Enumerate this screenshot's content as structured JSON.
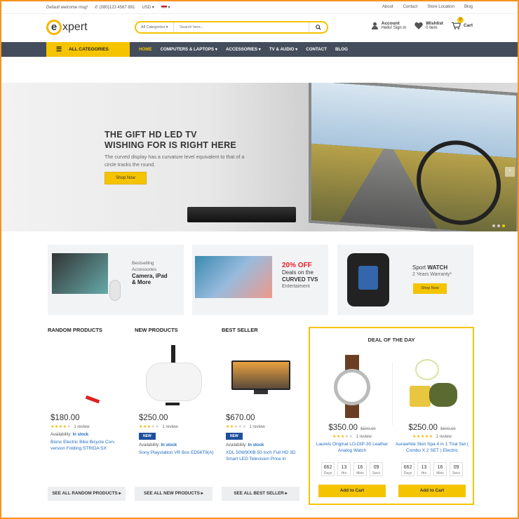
{
  "topbar": {
    "welcome": "Default welcome msg!",
    "phone": "(080)123 4567 891",
    "currency": "USD",
    "links": [
      "About",
      "Contact",
      "Store Location",
      "Blog"
    ]
  },
  "header": {
    "logo_letter": "e",
    "logo_text": "xpert",
    "search_category": "All Categories",
    "search_placeholder": "Search here...",
    "account_title": "Account",
    "account_sub": "Hello! Sign in",
    "wishlist_title": "Wishlist",
    "wishlist_sub": "0 item",
    "cart_count": "0",
    "cart_label": "Cart"
  },
  "nav": {
    "all_categories": "ALL CATEGORIES",
    "items": [
      "HOME",
      "COMPUTERS & LAPTOPS",
      "ACCESSORIES",
      "TV & AUDIO",
      "CONTACT",
      "BLOG"
    ]
  },
  "slider": {
    "title_1": "THE GIFT HD LED TV",
    "title_2": "WISHING FOR IS RIGHT HERE",
    "text": "The curved display has a curvature level equivalent to that of a circle tracks the round.",
    "button": "Shop Now"
  },
  "banners": {
    "b1": {
      "line1": "Bestselling",
      "line2": "Accessories",
      "bold1": "Camera, iPad",
      "bold2": "& More"
    },
    "b2": {
      "pct": "20% OFF",
      "line1": "Deals on the",
      "bold": "CURVED TVS",
      "line3": "Entertaiment"
    },
    "b3": {
      "line1": "Sport",
      "bold": "WATCH",
      "line2": "2 Years Warranty*",
      "button": "Shop Now"
    }
  },
  "sections": {
    "random": "RANDOM PRODUCTS",
    "new": "NEW PRODUCTS",
    "best": "BEST SELLER",
    "deal": "DEAL OF THE DAY"
  },
  "products": [
    {
      "price": "$180.00",
      "review": "1 review",
      "stars": 4,
      "avail_label": "Availability:",
      "avail": "In stock",
      "name": "Bionx Electric Bike Bicycle Con-version Folding STRIDA SX",
      "tag": ""
    },
    {
      "price": "$250.00",
      "review": "1 review",
      "stars": 3,
      "avail_label": "Availability:",
      "avail": "In stock",
      "name": "Sony Playstation VR Box ED56T9(A)",
      "tag": "NEW"
    },
    {
      "price": "$670.00",
      "review": "1 review",
      "stars": 2,
      "avail_label": "Availability:",
      "avail": "In stock",
      "name": "XDL 50W900B 50 Inch Full HD 3D Smart LED Television Price in",
      "tag": "NEW"
    }
  ],
  "see_all": [
    "SEE ALL RANDOM PRODUCTS",
    "SEE ALL NEW PRODUCTS",
    "SEE ALL BEST SELLER"
  ],
  "deals": [
    {
      "price": "$350.00",
      "old": "$500.00",
      "review": "1 review",
      "stars": 3,
      "name": "Laurels Original LO-DIP-30 Leather Analog Watch",
      "cd": [
        "662",
        "13",
        "16",
        "09"
      ],
      "button": "Add to Cart"
    },
    {
      "price": "$250.00",
      "old": "$600.00",
      "review": "1 review",
      "stars": 5,
      "name": "Aurawhite Skin Spa 4 in 1 Trial Set ( Combo X 2 SET ) Electric",
      "cd": [
        "662",
        "13",
        "16",
        "09"
      ],
      "button": "Add to Cart"
    }
  ],
  "countdown_labels": [
    "Days",
    "Hrs",
    "Mins",
    "Secs"
  ],
  "colors": {
    "accent": "#f5c400",
    "nav_bg": "#444d5b",
    "link": "#1f6bc4",
    "new_tag": "#1f4f9b",
    "sale": "#e31e24"
  }
}
